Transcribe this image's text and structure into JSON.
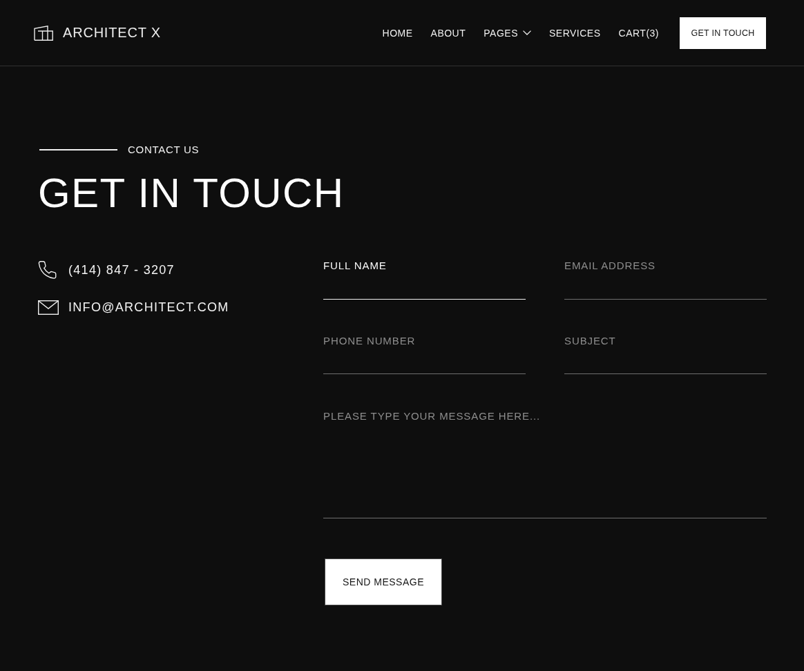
{
  "header": {
    "logo": "ARCHITECT X",
    "nav": [
      {
        "label": "HOME",
        "kind": "link"
      },
      {
        "label": "ABOUT",
        "kind": "link"
      },
      {
        "label": "PAGES",
        "kind": "dropdown"
      },
      {
        "label": "SERVICES",
        "kind": "link"
      },
      {
        "label": "CART(3)",
        "kind": "link"
      }
    ],
    "button": "GET IN TOUCH"
  },
  "hero": {
    "eyebrow": "CONTACT US",
    "title": "GET IN TOUCH"
  },
  "contact": [
    {
      "kind": "phone",
      "text": "(414) 847 - 3207"
    },
    {
      "kind": "email",
      "text": "INFO@ARCHITECT.COM"
    }
  ],
  "form": {
    "fields": [
      {
        "kind": "input",
        "placeholder": "FULL NAME",
        "focused": true
      },
      {
        "kind": "input",
        "placeholder": "EMAIL ADDRESS",
        "focused": false
      },
      {
        "kind": "input",
        "placeholder": "PHONE NUMBER",
        "focused": false
      },
      {
        "kind": "input",
        "placeholder": "SUBJECT",
        "focused": false
      },
      {
        "kind": "textarea",
        "placeholder": "PLEASE TYPE YOUR MESSAGE HERE...",
        "focused": false
      }
    ],
    "submit": "SEND MESSAGE"
  }
}
